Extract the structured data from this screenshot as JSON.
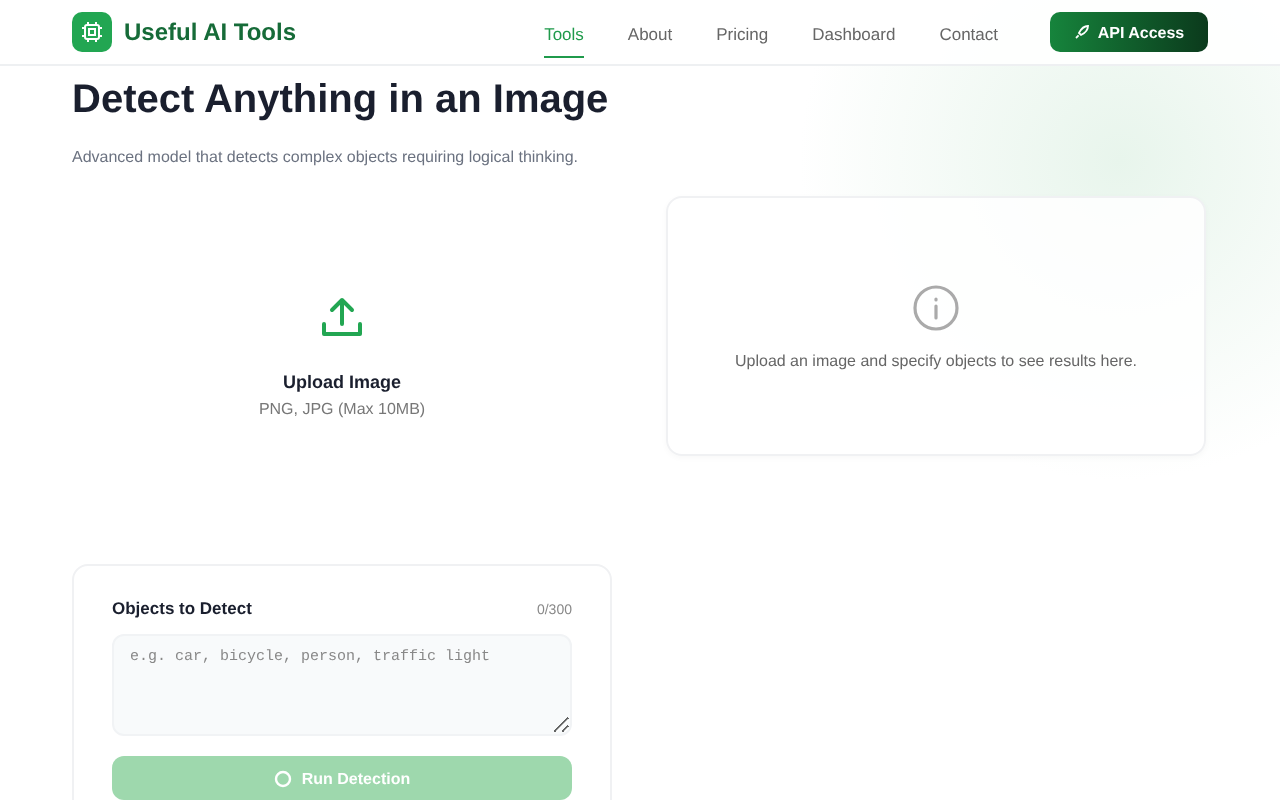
{
  "header": {
    "brand": "Useful AI Tools",
    "nav": [
      {
        "label": "Tools",
        "selected": true
      },
      {
        "label": "About",
        "selected": false
      },
      {
        "label": "Pricing",
        "selected": false
      },
      {
        "label": "Dashboard",
        "selected": false
      },
      {
        "label": "Contact",
        "selected": false
      }
    ],
    "cta": "API Access"
  },
  "title": "Detect Anything in an Image",
  "subtitle": "Advanced model that detects complex objects requiring logical thinking.",
  "upload": {
    "label": "Upload Image",
    "hint": "PNG, JPG (Max 10MB)"
  },
  "results": {
    "message": "Upload an image and specify objects to see results here."
  },
  "objects": {
    "label": "Objects to Detect",
    "counter": "0/300",
    "placeholder": "e.g. car, bicycle, person, traffic light",
    "button": {
      "label": "Run Detection",
      "disabled": true
    }
  }
}
